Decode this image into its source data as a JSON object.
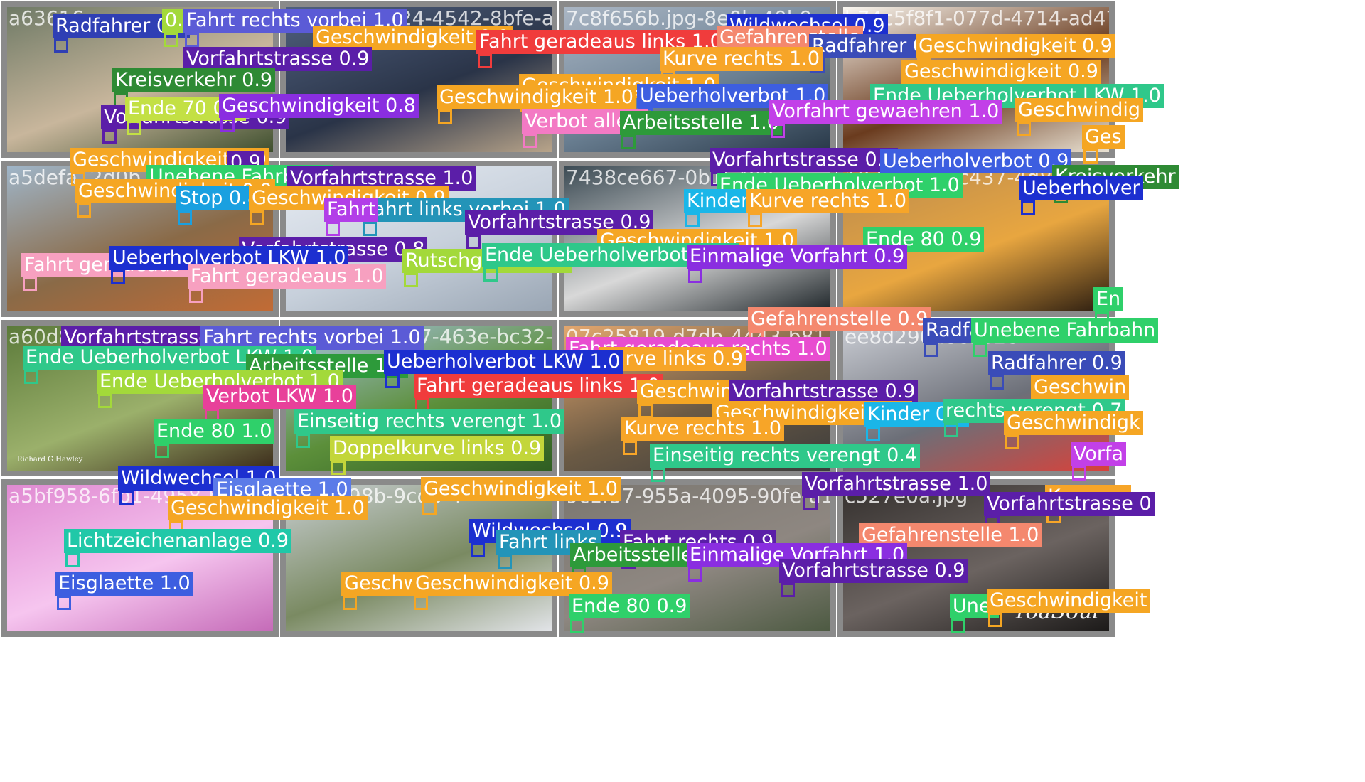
{
  "mosaic": {
    "tiles": [
      {
        "id": "t1",
        "filename": "a63616",
        "colors": [
          "#6f7a66",
          "#c8b69c",
          "#3e4f2e"
        ]
      },
      {
        "id": "t2",
        "filename": "2cb1950d324-4542-8bfe-a80c83e7",
        "colors": [
          "#50607e",
          "#2a3448",
          "#b8a48a"
        ]
      },
      {
        "id": "t3",
        "filename": "7c8f656b.jpg-8e0b-40b9",
        "colors": [
          "#aab6c4",
          "#6a7f92",
          "#283848"
        ]
      },
      {
        "id": "t4",
        "filename": "b74c5f8f1-077d-4714-ad47-278ae5",
        "colors": [
          "#fbf8f1",
          "#6a3b1e",
          "#e9e2d4"
        ]
      },
      {
        "id": "t5",
        "filename": "a5defa12d0b7-4",
        "colors": [
          "#9fb5c8",
          "#8a6a47",
          "#c26b35"
        ]
      },
      {
        "id": "t6",
        "filename": "9424c996c4",
        "colors": [
          "#e7ecf3",
          "#c7d0db",
          "#9aa6b4"
        ]
      },
      {
        "id": "t7",
        "filename": "7438ce667-0b1f-490",
        "colors": [
          "#3c4b54",
          "#d8d8d8",
          "#1f262a"
        ]
      },
      {
        "id": "t8",
        "filename": "1074b3da1c437-4d89-a",
        "colors": [
          "#b98a4f",
          "#e8a640",
          "#2a1c10"
        ]
      },
      {
        "id": "t9",
        "filename": "a60d8f",
        "colors": [
          "#5b7a3a",
          "#9bb06b",
          "#3b2a1a"
        ]
      },
      {
        "id": "t10",
        "filename": "848190c-8717-463e-bc32-7f17ee8",
        "colors": [
          "#a9c4e4",
          "#5c8f3a",
          "#2f5e22"
        ]
      },
      {
        "id": "t11",
        "filename": "07c25819-d7db-4443-b81",
        "colors": [
          "#e4a76e",
          "#6b5a44",
          "#3c3c3c"
        ]
      },
      {
        "id": "t12",
        "filename": "ee8d290a8c5b2c",
        "colors": [
          "#c9ccd3",
          "#6c6f78",
          "#d8423b"
        ]
      },
      {
        "id": "t13",
        "filename": "a5bf958-6fb1-4958-bf41",
        "colors": [
          "#e08ad2",
          "#f6c5ef",
          "#c56bb8"
        ]
      },
      {
        "id": "t14",
        "filename": "abb0c98b-9cdb-4",
        "colors": [
          "#c9cfd3",
          "#7a8a62",
          "#e2e4e8"
        ]
      },
      {
        "id": "t15",
        "filename": "9c1f37-955a-4095-90fe-a14",
        "colors": [
          "#7b7770",
          "#8e8781",
          "#4d5a42"
        ]
      },
      {
        "id": "t16",
        "filename": "c527e0a.jpg",
        "colors": [
          "#34302e",
          "#6b6360",
          "#1c1a19"
        ]
      }
    ],
    "watermark": "ToaSoul",
    "credit": "Richard G Hawley"
  },
  "labels": [
    {
      "text": "Radfahrer 0.6",
      "color": "#2f3fb4"
    },
    {
      "text": "0.8",
      "color": "#a3d93a"
    },
    {
      "text": "Fahrt rechts vorbei 1.0",
      "color": "#5b5bd6"
    },
    {
      "text": "Geschwindigkeit 0.9",
      "color": "#f5a623"
    },
    {
      "text": "Fahrt geradeaus links 1.0",
      "color": "#f03c3c"
    },
    {
      "text": "Wildwechsel 0.9",
      "color": "#1c2fd0"
    },
    {
      "text": "Gefahrenstelle",
      "color": "#f4886e"
    },
    {
      "text": "Radfahrer 0.9",
      "color": "#3a4cb8"
    },
    {
      "text": "Geschwindigkeit 0.9",
      "color": "#f5a623"
    },
    {
      "text": "Vorfahrtstrasse 0.9",
      "color": "#5b1ea8"
    },
    {
      "text": "Kurve rechts 1.0",
      "color": "#f7a528"
    },
    {
      "text": "Geschwindigkeit 0.9",
      "color": "#f5a623"
    },
    {
      "text": "Kreisverkehr 0.9",
      "color": "#2e8a34"
    },
    {
      "text": "Geschwindigkeit 1.0",
      "color": "#f5a623"
    },
    {
      "text": "Geschwindigkeit 1.0",
      "color": "#f5a623"
    },
    {
      "text": "Ueberholverbot 1.0",
      "color": "#3d5ee0"
    },
    {
      "text": "Ende Ueberholverbot LKW 1.0",
      "color": "#2fc88a"
    },
    {
      "text": "Vorfahrtstrasse 0.9",
      "color": "#5b1ea8"
    },
    {
      "text": "Ende 70 0.3",
      "color": "#c3e044"
    },
    {
      "text": "Geschwindigkeit 0.8",
      "color": "#8a2ee0"
    },
    {
      "text": "Verbot alle F",
      "color": "#f37ac4"
    },
    {
      "text": "Arbeitsstelle 1.0",
      "color": "#2d9a3a"
    },
    {
      "text": "Vorfahrt gewaehren 1.0",
      "color": "#c240e8"
    },
    {
      "text": "Geschwindig",
      "color": "#f5a623"
    },
    {
      "text": "Ges",
      "color": "#f5a623"
    },
    {
      "text": "Geschwindigkeit 0.9",
      "color": "#f5a623"
    },
    {
      "text": "0.9",
      "color": "#5b1ea8"
    },
    {
      "text": "Vorfahrtstrasse 0.9",
      "color": "#5b1ea8"
    },
    {
      "text": "Ueberholverbot 0.9",
      "color": "#3d5ee0"
    },
    {
      "text": "Unebene Fahrbahn",
      "color": "#2fd06a"
    },
    {
      "text": "Vorfahrtstrasse 1.0",
      "color": "#5b1ea8"
    },
    {
      "text": "Ende Ueberholverbot 1.0",
      "color": "#2fd06a"
    },
    {
      "text": "Kreisverkehr",
      "color": "#2e8a34"
    },
    {
      "text": "Ueberholver",
      "color": "#1c2fd0"
    },
    {
      "text": "Geschwindigkeit 0.9",
      "color": "#f5a623"
    },
    {
      "text": "Stop 0.8",
      "color": "#1aa0e0"
    },
    {
      "text": "Geschwindigkeit 0.9",
      "color": "#f5a623"
    },
    {
      "text": "Fahrt links vorbei 1.0",
      "color": "#2394b8"
    },
    {
      "text": "Fahrt",
      "color": "#b23ee8"
    },
    {
      "text": "Kinder 0.9",
      "color": "#1ab6e8"
    },
    {
      "text": "Kurve rechts 1.0",
      "color": "#f7a528"
    },
    {
      "text": "Vorfahrtstrasse 0.9",
      "color": "#5b1ea8"
    },
    {
      "text": "Ende 80 0.9",
      "color": "#2fd06a"
    },
    {
      "text": "Vorfahrtstrasse 0.8",
      "color": "#5b1ea8"
    },
    {
      "text": "Geschwindigkeit 1.0",
      "color": "#f5a623"
    },
    {
      "text": "Fahrt geradeaus 1.0",
      "color": "#f7a0c0"
    },
    {
      "text": "Ueberholverbot LKW 1.0",
      "color": "#1c2fd0"
    },
    {
      "text": "Rutschgefahr 0.9",
      "color": "#a3d93a"
    },
    {
      "text": "Ende Ueberholverbot LKW",
      "color": "#2fc88a"
    },
    {
      "text": "Einmalige Vorfahrt 0.9",
      "color": "#8a2ee0"
    },
    {
      "text": "Fahrt geradeaus 1.0",
      "color": "#f7a0c0"
    },
    {
      "text": "En",
      "color": "#2fd06a"
    },
    {
      "text": "Gefahrenstelle 0.9",
      "color": "#f4886e"
    },
    {
      "text": "Vorfahrtstrasse 1.0",
      "color": "#5b1ea8"
    },
    {
      "text": "Fahrt rechts vorbei 1.0",
      "color": "#5b5bd6"
    },
    {
      "text": "Radfa",
      "color": "#3a4cb8"
    },
    {
      "text": "Unebene Fahrbahn",
      "color": "#2fd06a"
    },
    {
      "text": "Ende Ueberholverbot LKW 1.0",
      "color": "#2fc88a"
    },
    {
      "text": "Fahrt geradeaus rechts 1.0",
      "color": "#e84cd0"
    },
    {
      "text": "Kurve links 0.9",
      "color": "#f7a528"
    },
    {
      "text": "Radfahrer 0.9",
      "color": "#3a4cb8"
    },
    {
      "text": "Arbeitsstelle 1.0",
      "color": "#2d9a3a"
    },
    {
      "text": "Ueberholverbot LKW 1.0",
      "color": "#1c2fd0"
    },
    {
      "text": "Ende Ueberholverbot 1.0",
      "color": "#a3d93a"
    },
    {
      "text": "Verbot LKW 1.0",
      "color": "#e8409a"
    },
    {
      "text": "Fahrt geradeaus links 1.0",
      "color": "#f03c3c"
    },
    {
      "text": "Geschwindi",
      "color": "#f5a623"
    },
    {
      "text": "Vorfahrtstrasse 0.9",
      "color": "#5b1ea8"
    },
    {
      "text": "Geschwin",
      "color": "#f5a623"
    },
    {
      "text": "Einseitig rechts verengt 1.0",
      "color": "#2fc88a"
    },
    {
      "text": "Geschwindigkeit 1.0",
      "color": "#f5a623"
    },
    {
      "text": "Kinder 0.4",
      "color": "#1ab6e8"
    },
    {
      "text": "rechts verengt 0.7",
      "color": "#2fc88a"
    },
    {
      "text": "Geschwindigk",
      "color": "#f5a623"
    },
    {
      "text": "Ende 80 1.0",
      "color": "#2fd06a"
    },
    {
      "text": "Kurve rechts 1.0",
      "color": "#f7a528"
    },
    {
      "text": "Doppelkurve links 0.9",
      "color": "#c3d63a"
    },
    {
      "text": "Einseitig rechts verengt 0.4",
      "color": "#2fc88a"
    },
    {
      "text": "Vorfa",
      "color": "#c240e8"
    },
    {
      "text": "Wildwechsel 1.0",
      "color": "#1c2fd0"
    },
    {
      "text": "Eisglaette 1.0",
      "color": "#5b7be8"
    },
    {
      "text": "Geschwindigkeit 1.0",
      "color": "#f5a623"
    },
    {
      "text": "Vorfahrtstrasse 1.0",
      "color": "#5b1ea8"
    },
    {
      "text": "Kurve re",
      "color": "#f7a528"
    },
    {
      "text": "Geschwindigkeit 1.0",
      "color": "#f5a623"
    },
    {
      "text": "Vorfahrtstrasse 0",
      "color": "#5b1ea8"
    },
    {
      "text": "Wildwechsel 0.9",
      "color": "#1c2fd0"
    },
    {
      "text": "Fahrt links",
      "color": "#2394b8"
    },
    {
      "text": "Fahrt rechts 0.9",
      "color": "#5b1ea8"
    },
    {
      "text": "Gefahrenstelle 1.0",
      "color": "#f4886e"
    },
    {
      "text": "Lichtzeichenanlage 0.9",
      "color": "#20c8a8"
    },
    {
      "text": "Arbeitsstelle 1.",
      "color": "#2d9a3a"
    },
    {
      "text": "Einmalige Vorfahrt 1.0",
      "color": "#8a2ee0"
    },
    {
      "text": "Vorfahrtstrasse 0.9",
      "color": "#5b1ea8"
    },
    {
      "text": "Eisglaette 1.0",
      "color": "#3d5ee0"
    },
    {
      "text": "Geschwir",
      "color": "#f5a623"
    },
    {
      "text": "Geschwindigkeit 0.9",
      "color": "#f5a623"
    },
    {
      "text": "Ende 80 0.9",
      "color": "#2fd06a"
    },
    {
      "text": "Unel",
      "color": "#2fd06a"
    },
    {
      "text": "Geschwindigkeit",
      "color": "#f5a623"
    }
  ]
}
